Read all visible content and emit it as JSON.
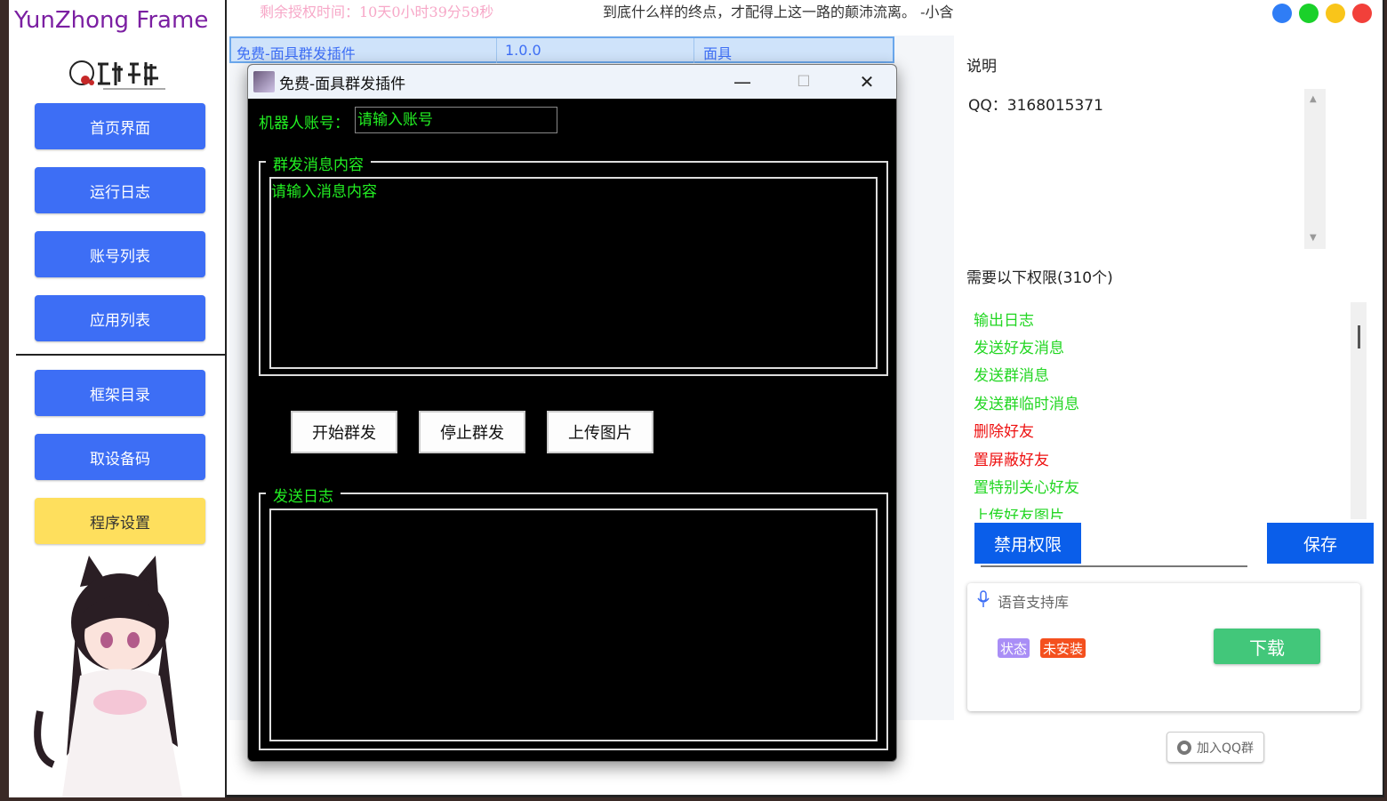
{
  "sidebar": {
    "title": "YunZhong Frame",
    "nav_top": [
      {
        "label": "首页界面"
      },
      {
        "label": "运行日志"
      },
      {
        "label": "账号列表"
      },
      {
        "label": "应用列表"
      }
    ],
    "nav_bottom": [
      {
        "label": "框架目录"
      },
      {
        "label": "取设备码"
      },
      {
        "label": "程序设置"
      }
    ]
  },
  "header": {
    "license": "剩余授权时间：10天0小时39分59秒",
    "quote": "到底什么样的终点，才配得上这一路的颠沛流离。  -小含",
    "window_dots": [
      "#2f7df6",
      "#1ad12a",
      "#f9c51a",
      "#f2403a"
    ]
  },
  "app_list": {
    "row": {
      "name": "免费-面具群发插件",
      "version": "1.0.0",
      "author": "面具"
    }
  },
  "right_panel": {
    "desc_title": "说明",
    "desc_text": "QQ：3168015371",
    "perm_title": "需要以下权限(310个)",
    "permissions": [
      {
        "label": "输出日志",
        "color": "#22d622"
      },
      {
        "label": "发送好友消息",
        "color": "#22d622"
      },
      {
        "label": "发送群消息",
        "color": "#22d622"
      },
      {
        "label": "发送群临时消息",
        "color": "#22d622"
      },
      {
        "label": "删除好友",
        "color": "#ee1111"
      },
      {
        "label": "置屏蔽好友",
        "color": "#ee1111"
      },
      {
        "label": "置特别关心好友",
        "color": "#22d622"
      },
      {
        "label": "上传好友图片",
        "color": "#22d622"
      }
    ],
    "ban_label": "禁用权限",
    "save_label": "保存"
  },
  "voice_card": {
    "title": "语音支持库",
    "status_label": "状态",
    "status_value": "未安装",
    "download_label": "下载",
    "status_label_color": "#a98ef6",
    "status_value_color": "#f4501e"
  },
  "qq_group_label": "加入QQ群",
  "dialog": {
    "title": "免费-面具群发插件",
    "account_label": "机器人账号：",
    "account_placeholder": "请输入账号",
    "message_group_label": "群发消息内容",
    "message_placeholder": "请输入消息内容",
    "start_label": "开始群发",
    "stop_label": "停止群发",
    "upload_label": "上传图片",
    "log_group_label": "发送日志",
    "minimize_glyph": "—",
    "maximize_glyph": "☐",
    "close_glyph": "✕"
  }
}
